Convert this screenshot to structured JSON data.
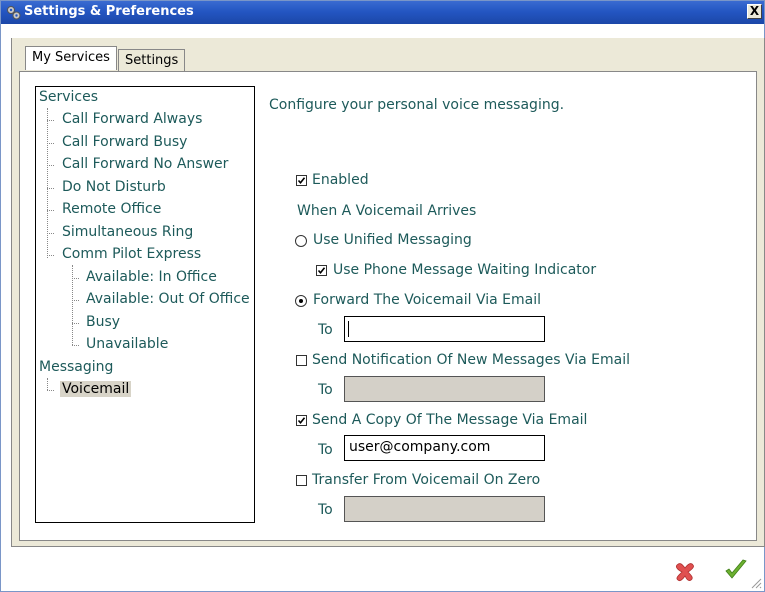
{
  "window": {
    "title": "Settings & Preferences",
    "close": "X"
  },
  "tabs": [
    {
      "label": "My Services"
    },
    {
      "label": "Settings"
    }
  ],
  "tree": {
    "services_label": "Services",
    "services": [
      "Call Forward Always",
      "Call Forward Busy",
      "Call Forward No Answer",
      "Do Not Disturb",
      "Remote Office",
      "Simultaneous Ring",
      "Comm Pilot Express"
    ],
    "commpilot_children": [
      "Available: In Office",
      "Available: Out Of Office",
      "Busy",
      "Unavailable"
    ],
    "messaging_label": "Messaging",
    "messaging": [
      "Voicemail"
    ],
    "selected": "Voicemail"
  },
  "form": {
    "intro": "Configure your personal voice messaging.",
    "enabled_label": "Enabled",
    "enabled": true,
    "arrives_label": "When A Voicemail Arrives",
    "unified_label": "Use Unified Messaging",
    "unified_selected": false,
    "mwi_label": "Use Phone Message Waiting Indicator",
    "mwi_checked": true,
    "forward_label": "Forward The Voicemail Via Email",
    "forward_selected": true,
    "to_label": "To",
    "forward_to_value": "",
    "notify_label": "Send Notification Of New Messages Via Email",
    "notify_checked": false,
    "notify_to_value": "",
    "copy_label": "Send A Copy Of The Message Via Email",
    "copy_checked": true,
    "copy_to_value": "user@company.com",
    "transfer_label": "Transfer From Voicemail On Zero",
    "transfer_checked": false,
    "transfer_to_value": ""
  },
  "buttons": {
    "cancel_icon": "red-x-icon",
    "ok_icon": "green-check-icon"
  },
  "colors": {
    "text": "#1d5a5a",
    "title_bar": "#2456c2",
    "cancel": "#e04040",
    "ok": "#5aa02a"
  }
}
